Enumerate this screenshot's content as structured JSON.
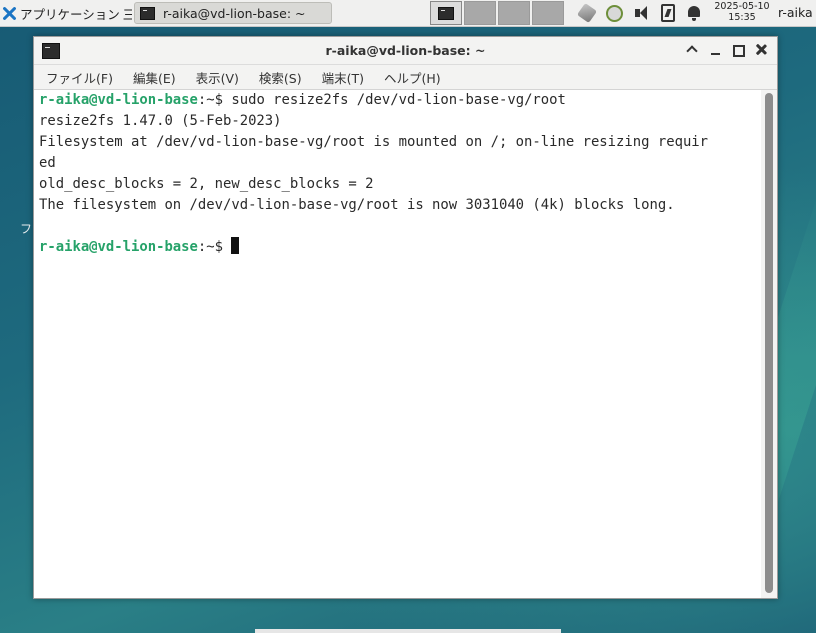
{
  "panel": {
    "apps_label": "アプリケーション",
    "apps_trail": "三",
    "task_title": "r-aika@vd-lion-base: ~",
    "clock_date": "2025-05-10",
    "clock_time": "15:35",
    "username": "r-aika"
  },
  "desktop": {
    "label": "フ"
  },
  "window": {
    "title": "r-aika@vd-lion-base: ~",
    "menu": [
      {
        "label": "ファイル(F)"
      },
      {
        "label": "編集(E)"
      },
      {
        "label": "表示(V)"
      },
      {
        "label": "検索(S)"
      },
      {
        "label": "端末(T)"
      },
      {
        "label": "ヘルプ(H)"
      }
    ]
  },
  "terminal": {
    "prompt_user": "r-aika@vd-lion-base",
    "prompt_path": ":~$",
    "command": " sudo resize2fs /dev/vd-lion-base-vg/root",
    "lines": [
      "resize2fs 1.47.0 (5-Feb-2023)",
      "Filesystem at /dev/vd-lion-base-vg/root is mounted on /; on-line resizing requir",
      "ed",
      "old_desc_blocks = 2, new_desc_blocks = 2",
      "The filesystem on /dev/vd-lion-base-vg/root is now 3031040 (4k) blocks long.",
      ""
    ],
    "prompt2_user": "r-aika@vd-lion-base",
    "prompt2_path": ":~$"
  }
}
